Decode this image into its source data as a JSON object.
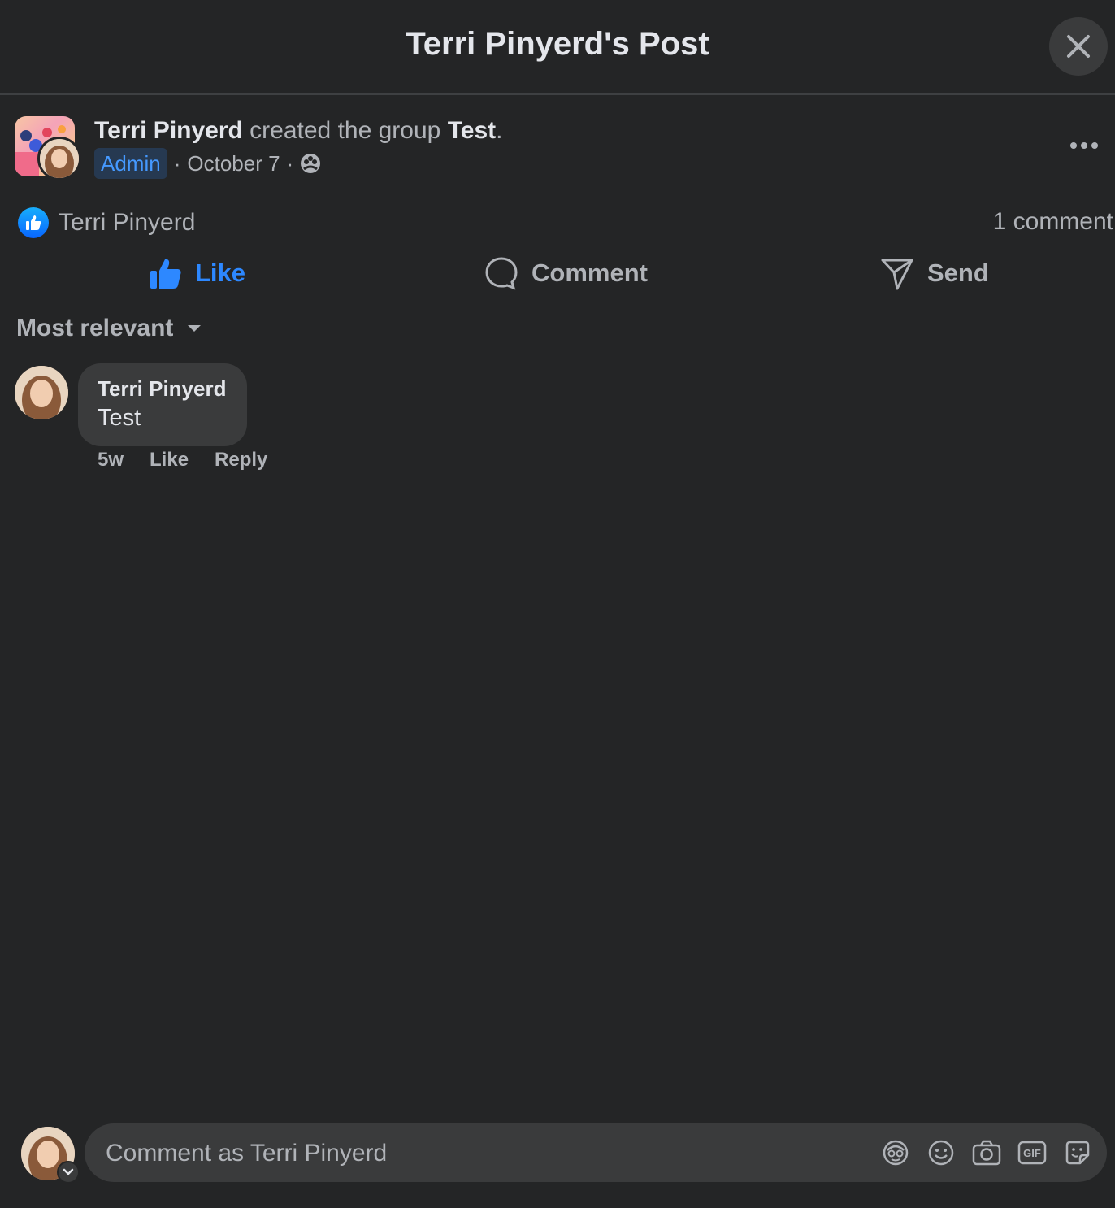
{
  "header": {
    "title": "Terri Pinyerd's Post"
  },
  "post": {
    "author": "Terri Pinyerd",
    "action_text": " created the group ",
    "group_name": "Test",
    "period": ".",
    "role_badge": "Admin",
    "separator": "·",
    "date": "October 7"
  },
  "reactions": {
    "reactor": "Terri Pinyerd",
    "comment_count": "1 comment"
  },
  "actions": {
    "like": "Like",
    "comment": "Comment",
    "send": "Send"
  },
  "sort": {
    "label": "Most relevant"
  },
  "comments": [
    {
      "author": "Terri Pinyerd",
      "text": "Test",
      "time": "5w",
      "like": "Like",
      "reply": "Reply"
    }
  ],
  "composer": {
    "placeholder": "Comment as Terri Pinyerd",
    "icons": [
      "avatar-sticker-icon",
      "emoji-icon",
      "camera-icon",
      "gif-icon",
      "sticker-icon"
    ]
  },
  "colors": {
    "background": "#242526",
    "surface": "#3a3b3c",
    "primary_text": "#e4e6eb",
    "secondary_text": "#b0b3b8",
    "accent_blue": "#2d88ff"
  }
}
